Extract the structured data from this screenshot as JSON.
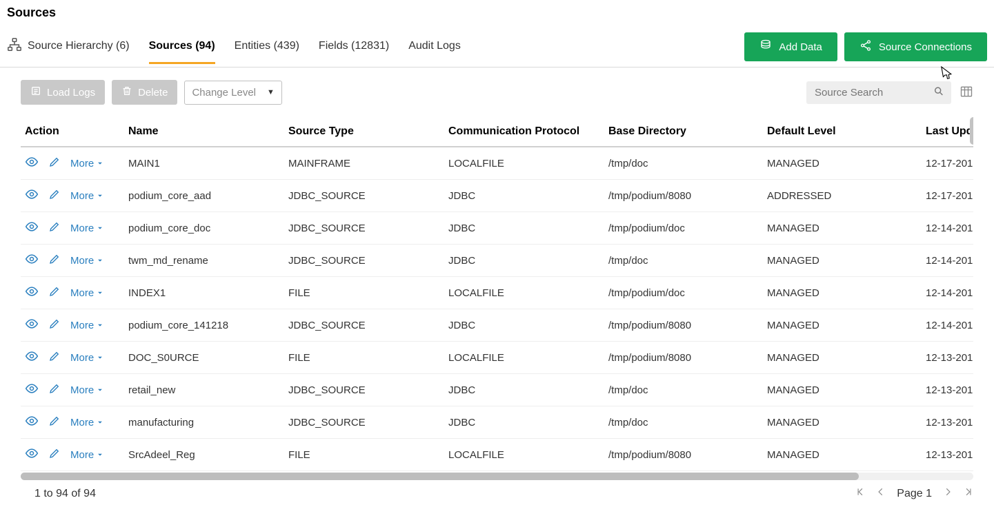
{
  "pageTitle": "Sources",
  "tabs": {
    "hierarchy": "Source Hierarchy (6)",
    "sources": "Sources (94)",
    "entities": "Entities (439)",
    "fields": "Fields (12831)",
    "audit": "Audit Logs"
  },
  "buttons": {
    "addData": "Add Data",
    "sourceConnections": "Source Connections",
    "loadLogs": "Load Logs",
    "delete": "Delete",
    "changeLevel": "Change Level",
    "more": "More"
  },
  "search": {
    "placeholder": "Source Search"
  },
  "columns": {
    "action": "Action",
    "name": "Name",
    "sourceType": "Source Type",
    "protocol": "Communication Protocol",
    "baseDir": "Base Directory",
    "level": "Default Level",
    "updated": "Last Updat"
  },
  "rows": [
    {
      "name": "MAIN1",
      "type": "MAINFRAME",
      "proto": "LOCALFILE",
      "dir": "/tmp/doc",
      "level": "MANAGED",
      "updated": "12-17-201"
    },
    {
      "name": "podium_core_aad",
      "type": "JDBC_SOURCE",
      "proto": "JDBC",
      "dir": "/tmp/podium/8080",
      "level": "ADDRESSED",
      "updated": "12-17-201"
    },
    {
      "name": "podium_core_doc",
      "type": "JDBC_SOURCE",
      "proto": "JDBC",
      "dir": "/tmp/podium/doc",
      "level": "MANAGED",
      "updated": "12-14-201"
    },
    {
      "name": "twm_md_rename",
      "type": "JDBC_SOURCE",
      "proto": "JDBC",
      "dir": "/tmp/doc",
      "level": "MANAGED",
      "updated": "12-14-201"
    },
    {
      "name": "INDEX1",
      "type": "FILE",
      "proto": "LOCALFILE",
      "dir": "/tmp/podium/doc",
      "level": "MANAGED",
      "updated": "12-14-201"
    },
    {
      "name": "podium_core_141218",
      "type": "JDBC_SOURCE",
      "proto": "JDBC",
      "dir": "/tmp/podium/8080",
      "level": "MANAGED",
      "updated": "12-14-201"
    },
    {
      "name": "DOC_S0URCE",
      "type": "FILE",
      "proto": "LOCALFILE",
      "dir": "/tmp/podium/8080",
      "level": "MANAGED",
      "updated": "12-13-201"
    },
    {
      "name": "retail_new",
      "type": "JDBC_SOURCE",
      "proto": "JDBC",
      "dir": "/tmp/doc",
      "level": "MANAGED",
      "updated": "12-13-201"
    },
    {
      "name": "manufacturing",
      "type": "JDBC_SOURCE",
      "proto": "JDBC",
      "dir": "/tmp/doc",
      "level": "MANAGED",
      "updated": "12-13-201"
    },
    {
      "name": "SrcAdeel_Reg",
      "type": "FILE",
      "proto": "LOCALFILE",
      "dir": "/tmp/podium/8080",
      "level": "MANAGED",
      "updated": "12-13-201"
    }
  ],
  "footer": {
    "range": "1 to 94 of 94",
    "pageLabel": "Page 1"
  }
}
